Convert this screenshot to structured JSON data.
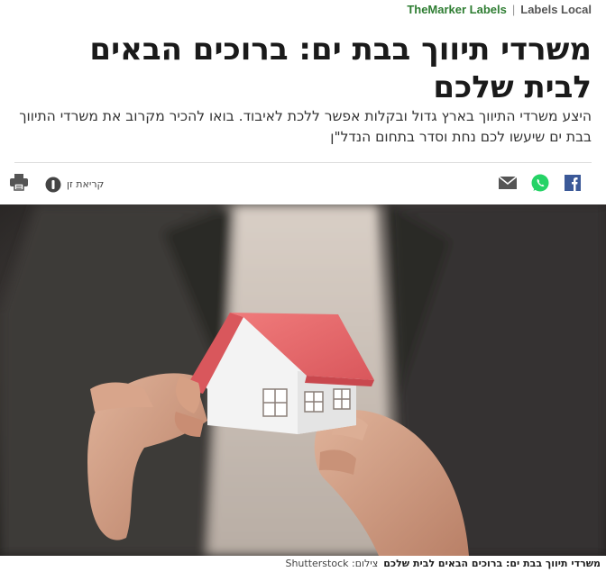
{
  "header": {
    "brand": "TheMarker Labels",
    "separator": "|",
    "section": "Labels Local"
  },
  "article": {
    "title": "משרדי תיווך בבת ים: ברוכים הבאים לבית שלכם",
    "subtitle": "היצע משרדי התיווך בארץ גדול ובקלות אפשר ללכת לאיבוד. בואו להכיר מקרוב את משרדי התיווך בבת ים שיעשו לכם נחת וסדר בתחום הנדל\"ן"
  },
  "toolbar": {
    "reader_mode_label": "קריאת זן",
    "icons": [
      "facebook-icon",
      "whatsapp-icon",
      "mail-icon",
      "reader-mode-icon",
      "print-icon"
    ]
  },
  "image": {
    "caption": "משרדי תיווך בבת ים: ברוכים הבאים לבית שלכם",
    "credit_label": "צילום:",
    "credit_source": "Shutterstock"
  },
  "colors": {
    "brand_green": "#2e7d32",
    "facebook_blue": "#3b5998",
    "whatsapp_green": "#25d366",
    "icon_gray": "#555555"
  }
}
